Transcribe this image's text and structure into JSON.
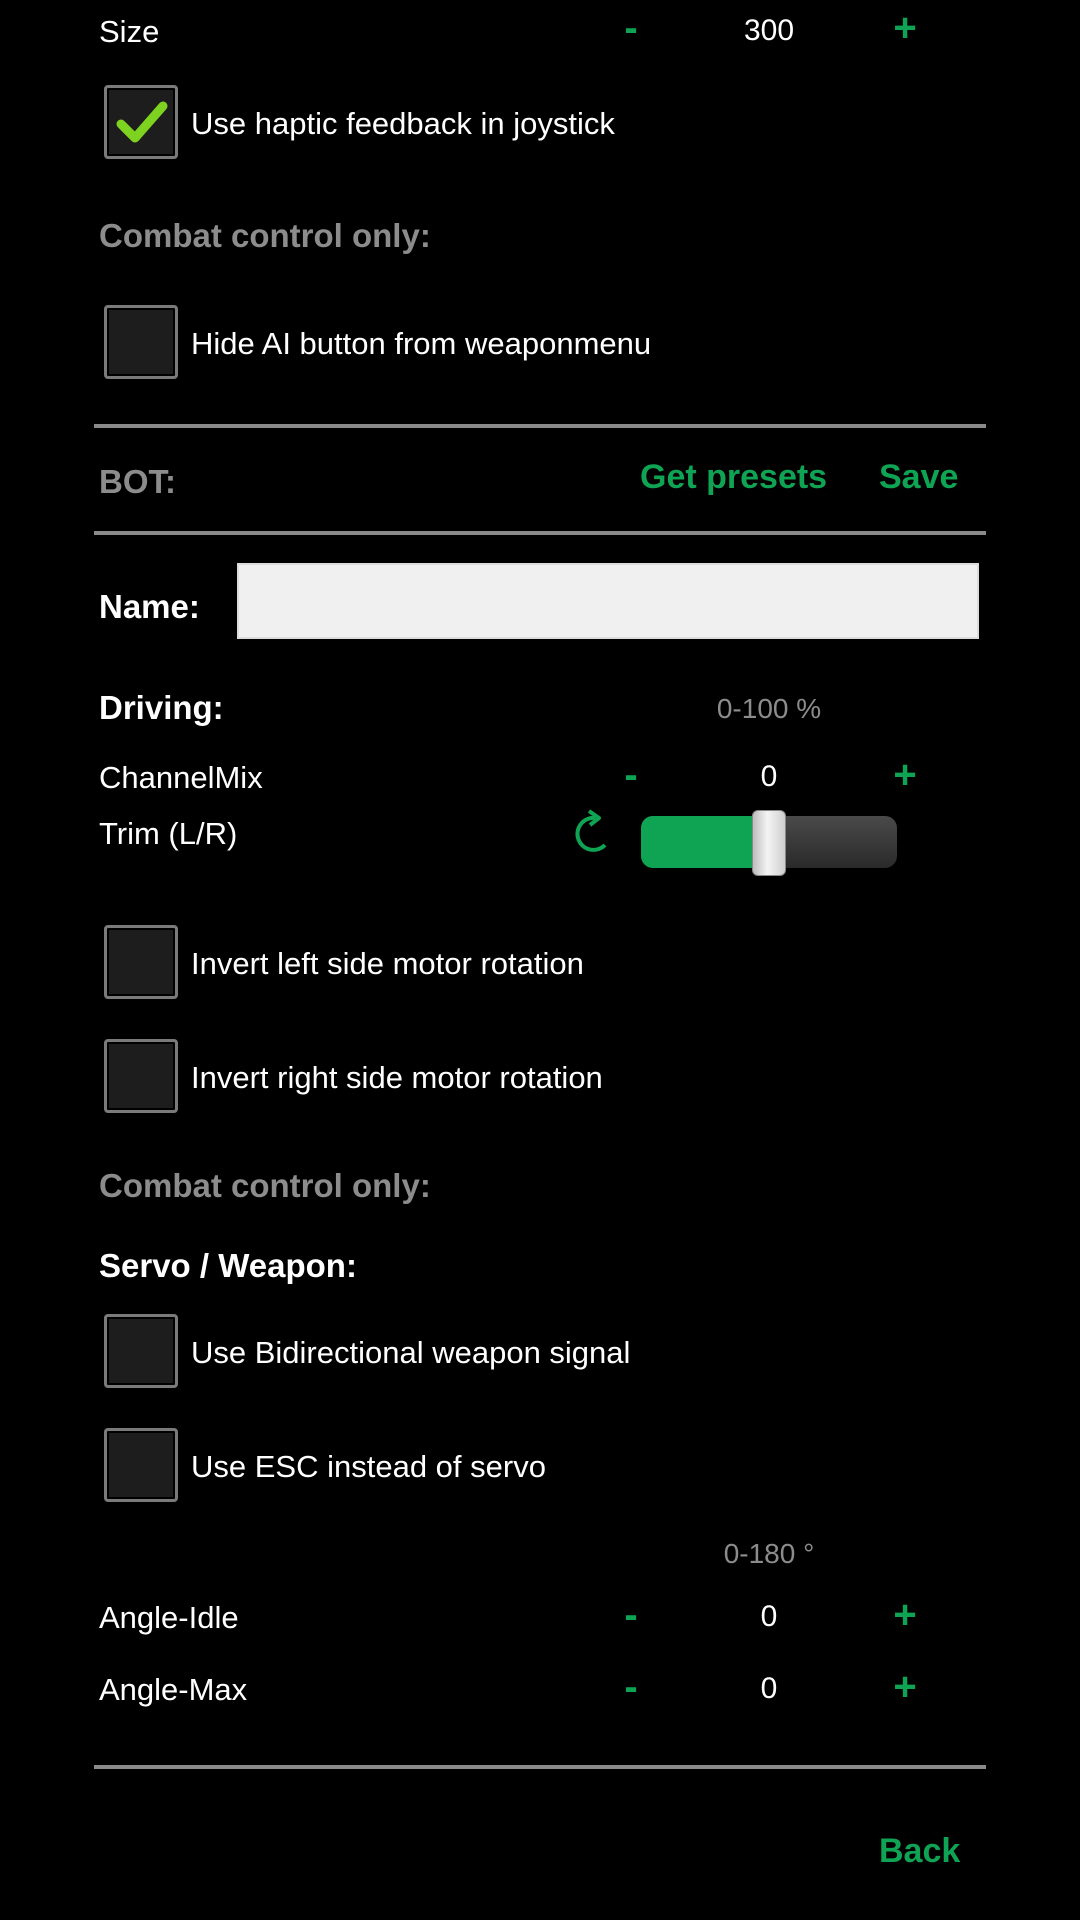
{
  "joystick": {
    "size_label": "Size",
    "size_value": "300",
    "minus": "-",
    "plus": "+",
    "haptic_label": "Use haptic feedback in joystick",
    "haptic_checked": true
  },
  "combat1": {
    "heading": "Combat control only:",
    "hide_ai_label": "Hide AI button from weaponmenu",
    "hide_ai_checked": false
  },
  "bot": {
    "heading": "BOT:",
    "get_presets": "Get presets",
    "save": "Save",
    "name_label": "Name:",
    "name_value": ""
  },
  "driving": {
    "heading": "Driving:",
    "range": "0-100 %",
    "channelmix_label": "ChannelMix",
    "channelmix_value": "0",
    "trim_label": "Trim (L/R)",
    "trim_level": 0.5,
    "invert_left_label": "Invert left side motor rotation",
    "invert_right_label": "Invert right side motor rotation"
  },
  "combat2": {
    "heading": "Combat control only:"
  },
  "servo": {
    "heading": "Servo / Weapon:",
    "bidirectional_label": "Use Bidirectional weapon signal",
    "esc_label": "Use ESC instead of servo",
    "range": "0-180 °",
    "angle_idle_label": "Angle-Idle",
    "angle_idle_value": "0",
    "angle_max_label": "Angle-Max",
    "angle_max_value": "0"
  },
  "footer": {
    "back": "Back"
  },
  "colors": {
    "accent": "#0fa453",
    "muted": "#8c8c8c"
  },
  "icons": {
    "check": "check-icon",
    "reset": "reset-rotate-icon"
  }
}
